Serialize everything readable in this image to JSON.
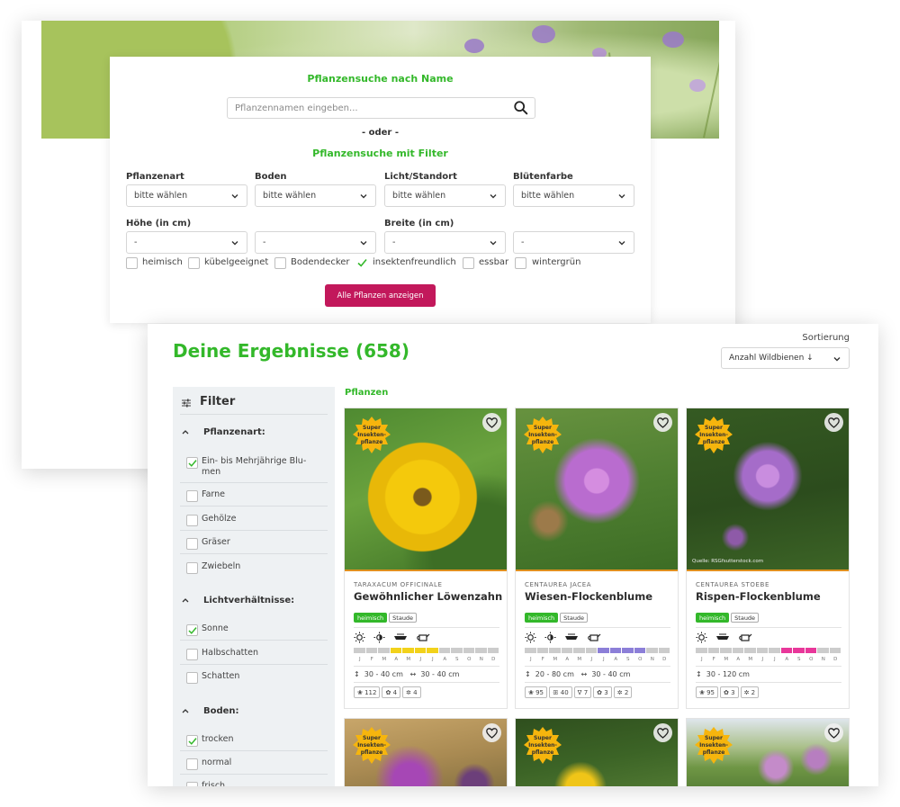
{
  "search": {
    "title_name": "Pflanzensuche nach Name",
    "name_placeholder": "Pflanzennamen eingeben...",
    "or_text": "- oder -",
    "title_filter": "Pflanzensuche mit Filter",
    "filters": [
      {
        "label": "Pflanzenart",
        "value": "bitte wählen"
      },
      {
        "label": "Boden",
        "value": "bitte wählen"
      },
      {
        "label": "Licht/Standort",
        "value": "bitte wählen"
      },
      {
        "label": "Blütenfarbe",
        "value": "bitte wählen"
      }
    ],
    "height_label": "Höhe (in cm)",
    "width_label": "Breite (in cm)",
    "range_values": [
      "-",
      "-",
      "-",
      "-"
    ],
    "checkboxes": [
      {
        "label": "heimisch",
        "checked": false
      },
      {
        "label": "kübelgeeignet",
        "checked": false
      },
      {
        "label": "Bodendecker",
        "checked": false
      },
      {
        "label": "insektenfreundlich",
        "checked": true
      },
      {
        "label": "essbar",
        "checked": false
      },
      {
        "label": "wintergrün",
        "checked": false
      }
    ],
    "submit_label": "Alle Pflanzen anzeigen"
  },
  "results": {
    "title": "Deine Ergebnisse (658)",
    "sort_label": "Sortierung",
    "sort_value": "Anzahl Wildbienen ↓",
    "section_label": "Pflanzen"
  },
  "sidebar": {
    "heading": "Filter",
    "sections": [
      {
        "title": "Pflanzenart:",
        "items": [
          {
            "label": "Ein- bis Mehrjährige Blu-",
            "label2": "men",
            "checked": true
          },
          {
            "label": "Farne",
            "checked": false
          },
          {
            "label": "Gehölze",
            "checked": false
          },
          {
            "label": "Gräser",
            "checked": false
          },
          {
            "label": "Zwiebeln",
            "checked": false
          }
        ]
      },
      {
        "title": "Lichtverhältnisse:",
        "items": [
          {
            "label": "Sonne",
            "checked": true
          },
          {
            "label": "Halbschatten",
            "checked": false
          },
          {
            "label": "Schatten",
            "checked": false
          }
        ]
      },
      {
        "title": "Boden:",
        "items": [
          {
            "label": "trocken",
            "checked": true
          },
          {
            "label": "normal",
            "checked": false
          },
          {
            "label": "frisch",
            "checked": false
          }
        ]
      }
    ]
  },
  "badge_text": [
    "Super",
    "Insekten-",
    "pflanze"
  ],
  "month_letters": [
    "J",
    "F",
    "M",
    "A",
    "M",
    "J",
    "J",
    "A",
    "S",
    "O",
    "N",
    "D"
  ],
  "plants": [
    {
      "latin": "TARAXACUM OFFICINALE",
      "name": "Gewöhnlicher Löwenzahn",
      "tags": [
        "heimisch",
        "Staude"
      ],
      "bloom_months": [
        3,
        4,
        5,
        6
      ],
      "bloom_color": "#f2d21b",
      "height": "30 - 40 cm",
      "width": "30 - 40 cm",
      "stats": [
        "112",
        "4",
        "4"
      ],
      "credit": ""
    },
    {
      "latin": "CENTAUREA JACEA",
      "name": "Wiesen-Flockenblume",
      "tags": [
        "heimisch",
        "Staude"
      ],
      "bloom_months": [
        6,
        7,
        8,
        9
      ],
      "bloom_color": "#8c7fd8",
      "height": "20 - 80 cm",
      "width": "30 - 40 cm",
      "stats": [
        "95",
        "40",
        "7",
        "3",
        "2"
      ],
      "credit": ""
    },
    {
      "latin": "CENTAUREA STOEBE",
      "name": "Rispen-Flockenblume",
      "tags": [
        "heimisch",
        "Staude"
      ],
      "bloom_months": [
        7,
        8,
        9
      ],
      "bloom_color": "#e8379a",
      "height": "30 - 120 cm",
      "width": "",
      "stats": [
        "95",
        "3",
        "2"
      ],
      "credit": "Quelle: RSGfsutterstock.com"
    }
  ],
  "colors": {
    "accent_green": "#33b82a",
    "button_magenta": "#c2185b",
    "badge_yellow": "#f6b50d",
    "photo_border_orange": "#e0901f"
  }
}
